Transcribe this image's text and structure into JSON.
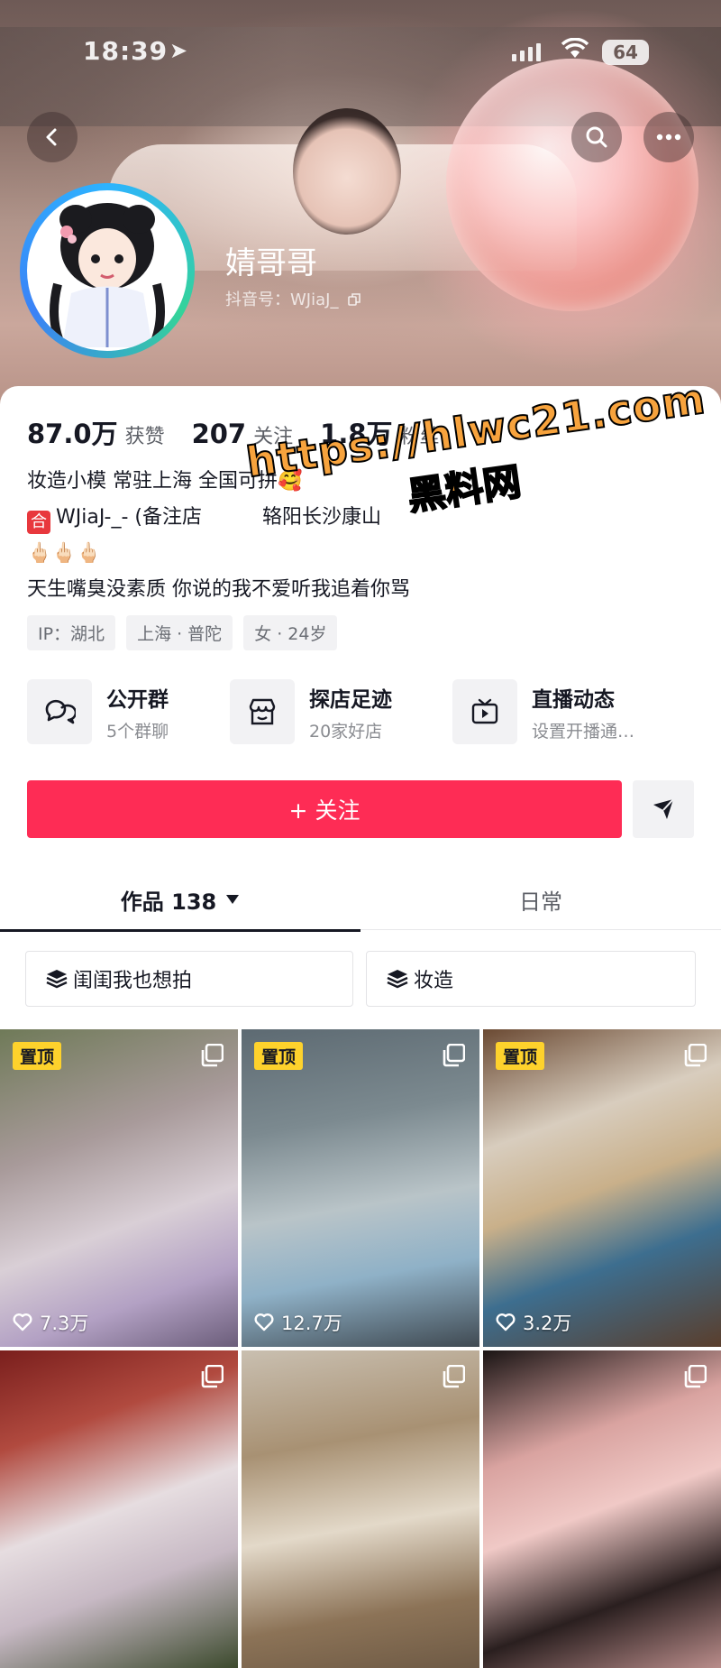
{
  "status_bar": {
    "time": "18:39",
    "battery": "64"
  },
  "profile": {
    "name": "婧哥哥",
    "douyin_id": "抖音号：WJiaJ_"
  },
  "stats": [
    {
      "value": "87.0万",
      "label": "获赞"
    },
    {
      "value": "207",
      "label": "关注"
    },
    {
      "value": "1.8万",
      "label": "粉丝"
    }
  ],
  "bio": {
    "line1": "妆造小模 常驻上海 全国可拼🥰",
    "badge": "合",
    "line2": "WJiaJ-_- (备注店",
    "line2_tail": "辂阳长沙康山",
    "line3": "🖕🏻🖕🏻🖕🏻",
    "line4": "天生嘴臭没素质 你说的我不爱听我追着你骂"
  },
  "tags": [
    "IP：湖北",
    "上海 · 普陀",
    "女 · 24岁"
  ],
  "shortcuts": [
    {
      "title": "公开群",
      "subtitle": "5个群聊",
      "icon": "chat-bubbles-icon"
    },
    {
      "title": "探店足迹",
      "subtitle": "20家好店",
      "icon": "store-icon"
    },
    {
      "title": "直播动态",
      "subtitle": "设置开播通…",
      "icon": "tv-icon"
    }
  ],
  "follow_button": "+ 关注",
  "tabs": {
    "works": "作品 138",
    "daily": "日常"
  },
  "filters": [
    "闺闺我也想拍",
    "妆造"
  ],
  "videos": [
    {
      "pinned": "置顶",
      "likes": "7.3万"
    },
    {
      "pinned": "置顶",
      "likes": "12.7万"
    },
    {
      "pinned": "置顶",
      "likes": "3.2万"
    },
    {
      "pinned": "",
      "likes": ""
    },
    {
      "pinned": "",
      "likes": ""
    },
    {
      "pinned": "",
      "likes": ""
    }
  ],
  "watermark": {
    "url": "https://hlwc21.com",
    "name": "黑料网"
  },
  "colors": {
    "accent": "#fe2c55",
    "pin": "#fed22c",
    "watermark": "#f7a33d"
  }
}
